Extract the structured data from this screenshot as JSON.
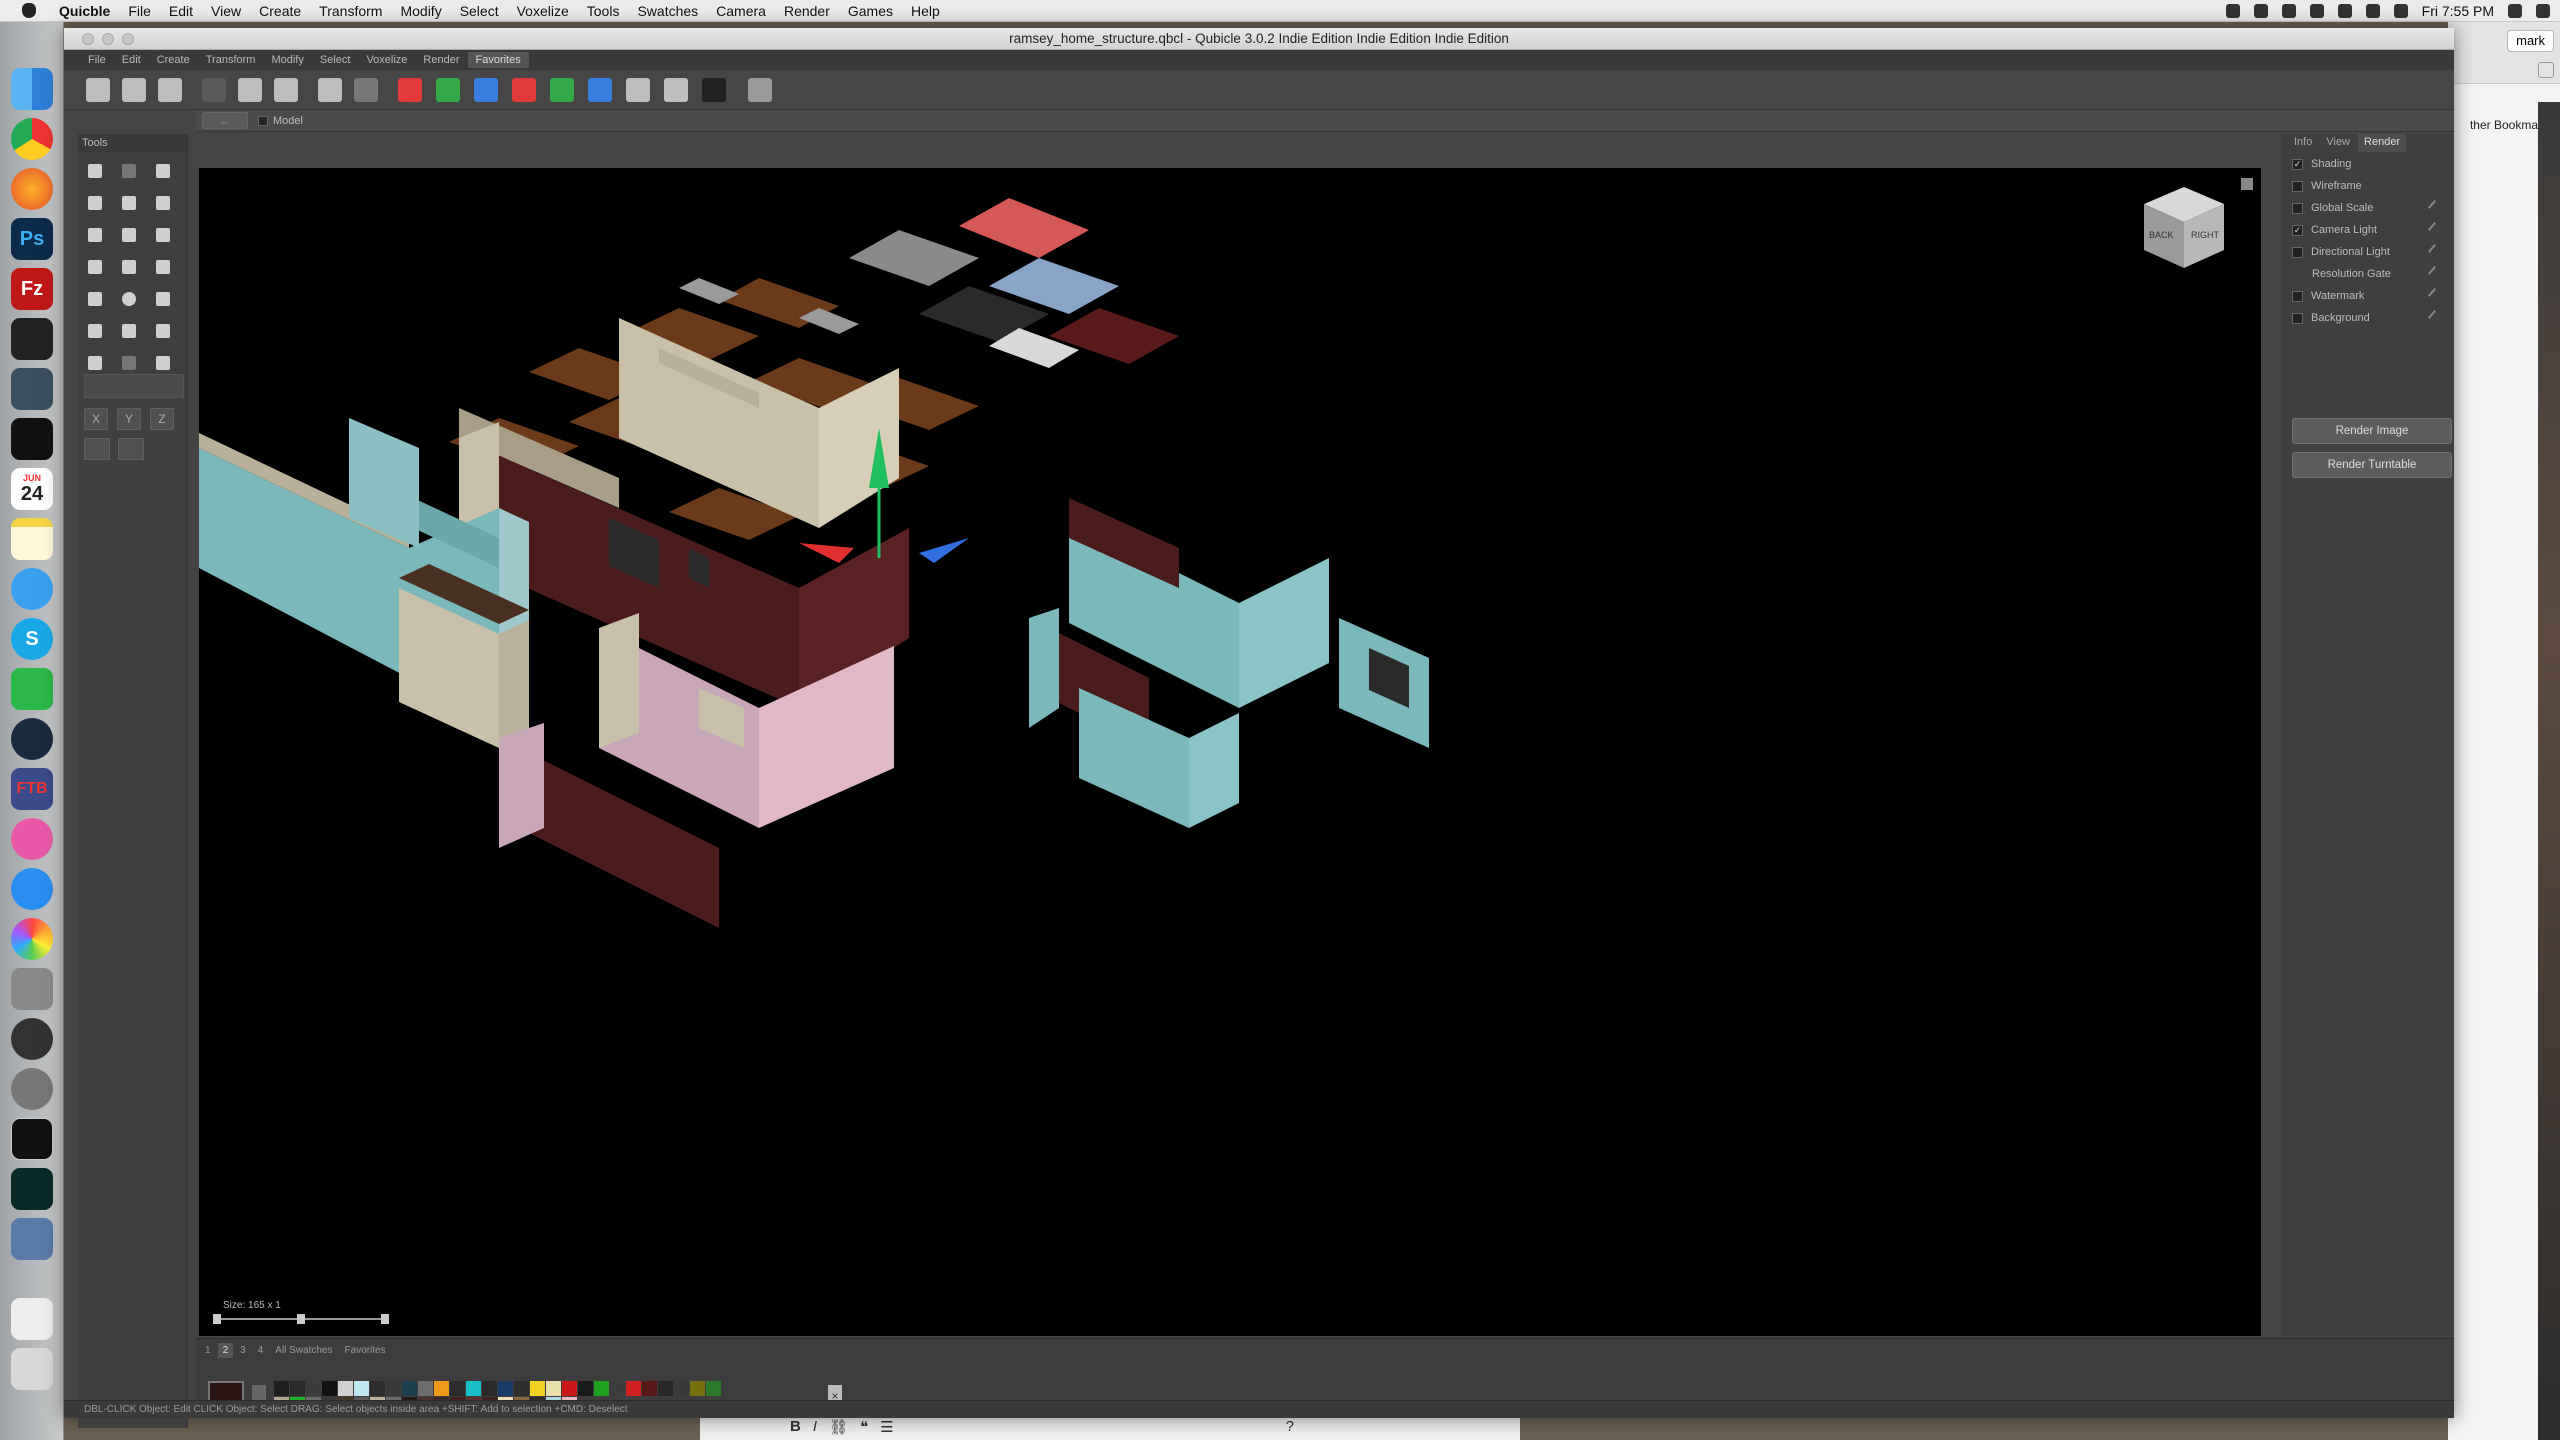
{
  "os_menubar": {
    "app": "Quicble",
    "items": [
      "File",
      "Edit",
      "View",
      "Create",
      "Transform",
      "Modify",
      "Select",
      "Voxelize",
      "Tools",
      "Swatches",
      "Camera",
      "Render",
      "Games",
      "Help"
    ],
    "clock": "Fri 7:55 PM"
  },
  "dock": {
    "calendar_day": "24",
    "calendar_month": "JUN"
  },
  "background_window": {
    "user_button": "mark",
    "bookmarks": "ther Bookmarks"
  },
  "window": {
    "title": "ramsey_home_structure.qbcl - Qubicle 3.0.2 Indie Edition Indie Edition Indie Edition"
  },
  "app_menu": {
    "items": [
      "File",
      "Edit",
      "Create",
      "Transform",
      "Modify",
      "Select",
      "Voxelize",
      "Render",
      "Favorites"
    ],
    "active": "Favorites"
  },
  "breadcrumb": {
    "back": "←",
    "model": "Model"
  },
  "tools_panel": {
    "title": "Tools",
    "axes": [
      "X",
      "Y",
      "Z"
    ]
  },
  "viewport": {
    "size_indicator": "Size: 165 x 1",
    "view_cube": {
      "face_left": "BACK",
      "face_right": "RIGHT"
    }
  },
  "right_panel": {
    "tabs": [
      "Info",
      "View",
      "Render"
    ],
    "active_tab": "Render",
    "options": [
      {
        "label": "Shading",
        "checked": true,
        "editable": false
      },
      {
        "label": "Wireframe",
        "checked": false,
        "editable": false
      },
      {
        "label": "Global Scale",
        "checked": false,
        "editable": true
      },
      {
        "label": "Camera Light",
        "checked": true,
        "editable": true
      },
      {
        "label": "Directional Light",
        "checked": false,
        "editable": true
      },
      {
        "label": "Resolution Gate",
        "checked": null,
        "editable": true
      },
      {
        "label": "Watermark",
        "checked": false,
        "editable": true
      },
      {
        "label": "Background",
        "checked": false,
        "editable": true
      }
    ],
    "render_image": "Render Image",
    "render_turntable": "Render Turntable"
  },
  "swatches": {
    "tabs": [
      "1",
      "2",
      "3",
      "4",
      "All Swatches",
      "Favorites"
    ],
    "active_tab": "2",
    "close": "×",
    "colors": [
      "#1e1e1e",
      "#2a2a2a",
      "#3c3c3c",
      "#121212",
      "#d0d0d0",
      "#bde8f2",
      "#2e2e2e",
      "#3a3a3a",
      "#1c4050",
      "#6c6c6c",
      "#f09a1a",
      "#2c2c2c",
      "#18c0c8",
      "#2a2a2a",
      "#1a3a6a",
      "#2e2e2e",
      "#f0d020",
      "#e8e0a8",
      "#c81818",
      "#1a1a1a",
      "#20a020",
      "#3c3c3c",
      "#d02020",
      "#581818",
      "#282828",
      "#3a3a3a",
      "#787010",
      "#2a7a2a",
      "#b0a890",
      "#20b030",
      "#6a6a6a",
      "#383838",
      "#483828",
      "#585858",
      "#bcb4a0",
      "#6a6a6a",
      "#241818",
      "#4a3030",
      "#3a2a2a",
      "#442020",
      "#5a3030",
      "#3e2222",
      "#e8ddc0",
      "#886a3a",
      "#2c2c2c",
      "#b0d8e0",
      "#ecb8c8"
    ]
  },
  "statusbar": {
    "text": "DBL-CLICK Object: Edit   CLICK Object: Select   DRAG: Select objects inside area   +SHIFT: Add to selection   +CMD: Deselect"
  }
}
